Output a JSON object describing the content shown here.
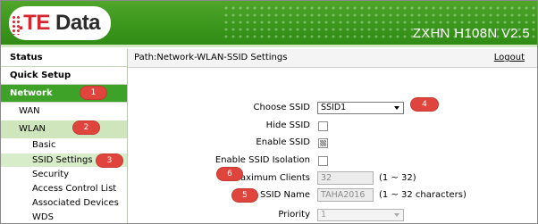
{
  "header": {
    "logo_te": ".TE",
    "logo_data": " Data",
    "model": "ZXHN H108N V2.5"
  },
  "sidebar": {
    "status": "Status",
    "quick_setup": "Quick Setup",
    "network": "Network",
    "wan": "WAN",
    "wlan": "WLAN",
    "wlan_items": [
      "Basic",
      "SSID Settings",
      "Security",
      "Access Control List",
      "Associated Devices",
      "WDS"
    ]
  },
  "path_bar": {
    "path": "Path:Network-WLAN-SSID Settings",
    "logout": "Logout"
  },
  "form": {
    "choose_ssid_label": "Choose SSID",
    "choose_ssid_value": "SSID1",
    "hide_ssid_label": "Hide SSID",
    "hide_ssid_checked": false,
    "enable_ssid_label": "Enable SSID",
    "enable_ssid_checked": true,
    "enable_isolation_label": "Enable SSID Isolation",
    "enable_isolation_checked": false,
    "max_clients_label": "Maximum Clients",
    "max_clients_value": "32",
    "max_clients_hint": "(1 ~ 32)",
    "ssid_name_label": "SSID Name",
    "ssid_name_value": "TAHA2016",
    "ssid_name_hint": "(1 ~ 32 characters)",
    "priority_label": "Priority",
    "priority_value": "1"
  },
  "markers": [
    "1",
    "2",
    "3",
    "4",
    "5",
    "6"
  ],
  "colors": {
    "brand_green": "#3ea228",
    "marker_red": "#e0453d",
    "logo_red": "#d8262e"
  }
}
